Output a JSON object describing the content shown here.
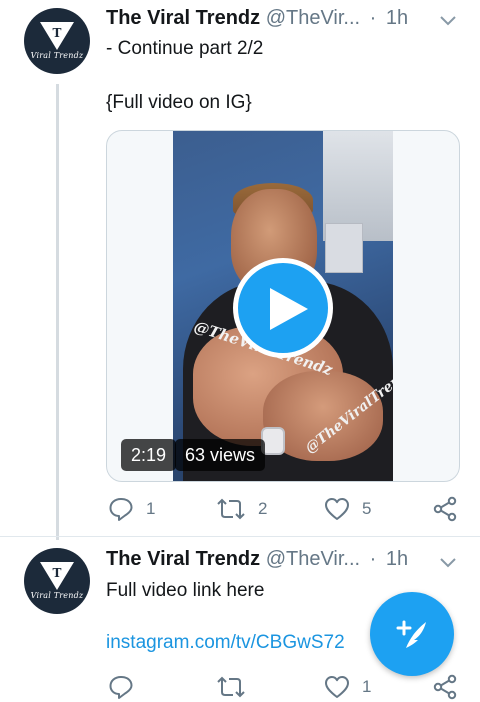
{
  "tweets": [
    {
      "author_name": "The Viral Trendz",
      "handle": "@TheVir...",
      "dot": "·",
      "time": "1h",
      "avatar_text": "Viral Trendz",
      "lines": [
        "- Continue part 2/2",
        "{Full video on IG}"
      ],
      "media": {
        "type": "video",
        "duration": "2:19",
        "views": "63 views",
        "watermark_text": "@TheViralTrendz"
      },
      "actions": {
        "reply_count": "1",
        "retweet_count": "2",
        "like_count": "5"
      }
    },
    {
      "author_name": "The Viral Trendz",
      "handle": "@TheVir...",
      "dot": "·",
      "time": "1h",
      "avatar_text": "Viral Trendz",
      "lines": [
        "Full video link here"
      ],
      "link": "instagram.com/tv/CBGwS72",
      "actions": {
        "reply_count": "",
        "retweet_count": "",
        "like_count": "1"
      }
    }
  ],
  "icons": {
    "reply": "reply-icon",
    "retweet": "retweet-icon",
    "like": "heart-icon",
    "share": "share-icon",
    "caret": "chevron-down-icon",
    "play": "play-icon",
    "compose": "compose-tweet-icon"
  },
  "colors": {
    "accent": "#1da1f2",
    "link": "#1b95e0",
    "muted": "#657786",
    "avatar_bg": "#1c2a3a"
  }
}
